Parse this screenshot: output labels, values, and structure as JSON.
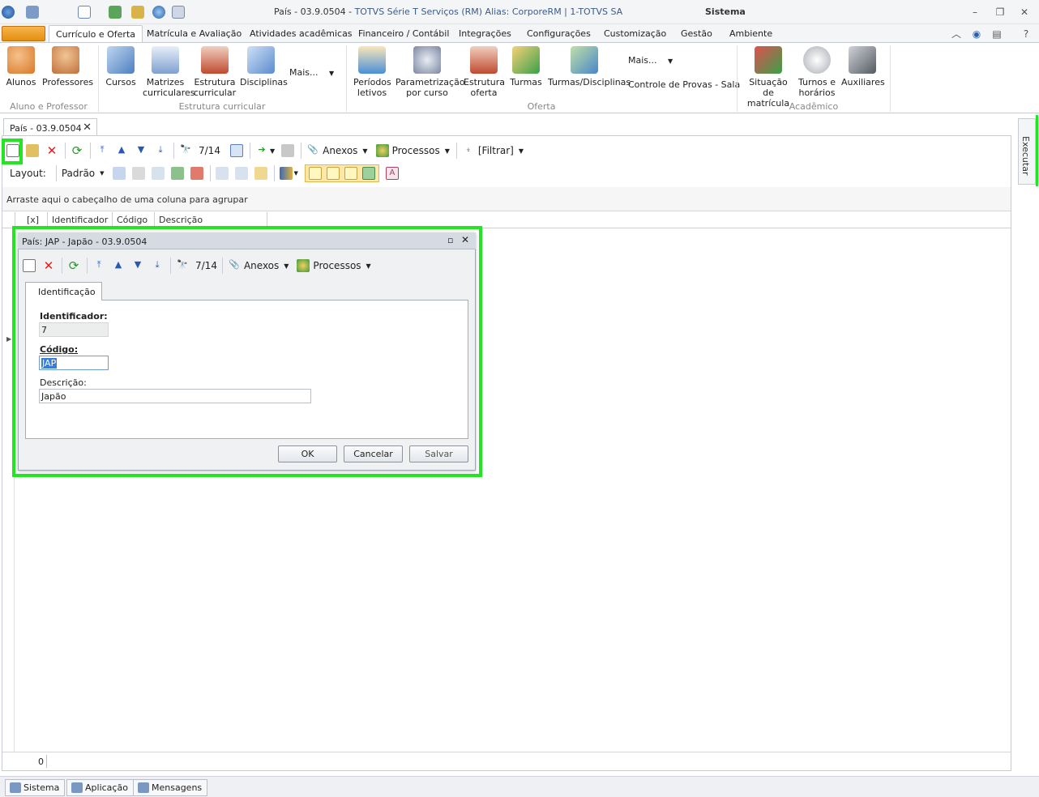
{
  "window": {
    "title_main": "País - 03.9.0504 - ",
    "title_app": "TOTVS Série T Serviços (RM) Alias: CorporeRM | 1-TOTVS SA",
    "context": "Sistema"
  },
  "ribbon_tabs": [
    "Currículo e Oferta",
    "Matrícula e Avaliação",
    "Atividades acadêmicas",
    "Financeiro / Contábil",
    "Integrações",
    "Configurações",
    "Customização",
    "Gestão",
    "Ambiente"
  ],
  "ribbon": {
    "group1": {
      "label": "Aluno e Professor",
      "buttons": [
        "Alunos",
        "Professores"
      ]
    },
    "group2": {
      "label": "Estrutura curricular",
      "buttons": [
        "Cursos",
        "Matrizes curriculares",
        "Estrutura curricular",
        "Disciplinas"
      ],
      "more": "Mais..."
    },
    "group3": {
      "label": "Oferta",
      "buttons": [
        "Períodos letivos",
        "Parametrização por curso",
        "Estrutura oferta",
        "Turmas",
        "Turmas/Disciplinas"
      ],
      "more": "Mais...",
      "extra": "Controle de Provas - Sala"
    },
    "group4": {
      "label": "Acadêmico",
      "buttons": [
        "Situação de matrícula",
        "Turnos e horários",
        "Auxiliares"
      ]
    }
  },
  "doc_tab": "País - 03.9.0504",
  "toolbar": {
    "record": "7/14",
    "anexos": "Anexos",
    "processos": "Processos",
    "filtrar": "[Filtrar]"
  },
  "layout_bar": {
    "label": "Layout:",
    "value": "Padrão"
  },
  "grid": {
    "group_hint": "Arraste aqui o cabeçalho de uma coluna para agrupar",
    "columns": [
      "[x]",
      "Identificador",
      "Código",
      "Descrição"
    ],
    "count": "0"
  },
  "execute_panel": "Executar",
  "dialog": {
    "title": "País: JAP - Japão - 03.9.0504",
    "record": "7/14",
    "anexos": "Anexos",
    "processos": "Processos",
    "tab": "Identificação",
    "fields": {
      "id_label": "Identificador:",
      "id_value": "7",
      "code_label": "Código:",
      "code_value": "JAP",
      "desc_label": "Descrição:",
      "desc_value": "Japão"
    },
    "buttons": {
      "ok": "OK",
      "cancel": "Cancelar",
      "save": "Salvar"
    }
  },
  "bottom_tabs": [
    "Sistema",
    "Aplicação",
    "Mensagens"
  ],
  "colors": {
    "highlight": "#22e622",
    "file_button": "#e58e10"
  }
}
